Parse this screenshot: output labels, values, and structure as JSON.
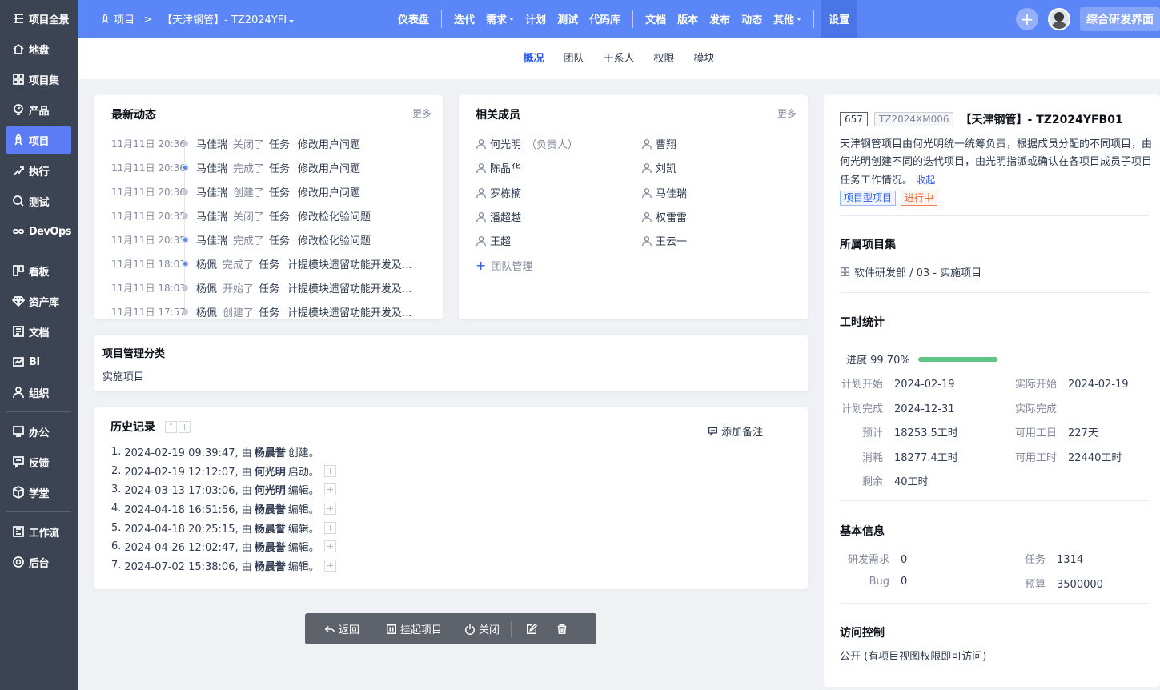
{
  "sidebar": {
    "items": [
      {
        "label": "项目全景",
        "icon": "dashboard-icon"
      },
      {
        "label": "地盘",
        "icon": "home-icon"
      },
      {
        "label": "项目集",
        "icon": "grid-icon"
      },
      {
        "label": "产品",
        "icon": "bulb-icon"
      },
      {
        "label": "项目",
        "icon": "rocket-icon"
      },
      {
        "label": "执行",
        "icon": "run-icon"
      },
      {
        "label": "测试",
        "icon": "search-icon"
      },
      {
        "label": "DevOps",
        "icon": "infinity-icon"
      },
      {
        "label": "看板",
        "icon": "kanban-icon"
      },
      {
        "label": "资产库",
        "icon": "diamond-icon"
      },
      {
        "label": "文档",
        "icon": "doc-icon"
      },
      {
        "label": "BI",
        "icon": "chart-icon"
      },
      {
        "label": "组织",
        "icon": "user-icon"
      },
      {
        "label": "办公",
        "icon": "monitor-icon"
      },
      {
        "label": "反馈",
        "icon": "feedback-icon"
      },
      {
        "label": "学堂",
        "icon": "cube-icon"
      },
      {
        "label": "工作流",
        "icon": "workflow-icon"
      },
      {
        "label": "后台",
        "icon": "settings-icon"
      }
    ]
  },
  "topbar": {
    "crumb_home": "项目",
    "crumb_project": "【天津钢管】- TZ2024YFI",
    "nav": [
      {
        "label": "仪表盘"
      },
      {
        "label": "迭代"
      },
      {
        "label": "需求"
      },
      {
        "label": "计划"
      },
      {
        "label": "测试"
      },
      {
        "label": "代码库"
      },
      {
        "label": "文档"
      },
      {
        "label": "版本"
      },
      {
        "label": "发布"
      },
      {
        "label": "动态"
      },
      {
        "label": "其他"
      },
      {
        "label": "设置"
      }
    ],
    "workspace": "综合研发界面"
  },
  "subnav": {
    "tabs": [
      "概况",
      "团队",
      "干系人",
      "权限",
      "模块"
    ]
  },
  "activity": {
    "title": "最新动态",
    "more": "更多",
    "rows": [
      {
        "time": "11月11日 20:36",
        "user": "马佳瑞",
        "action": "关闭了",
        "type": "任务",
        "object": "修改用户问题"
      },
      {
        "time": "11月11日 20:36",
        "user": "马佳瑞",
        "action": "完成了",
        "type": "任务",
        "object": "修改用户问题"
      },
      {
        "time": "11月11日 20:36",
        "user": "马佳瑞",
        "action": "创建了",
        "type": "任务",
        "object": "修改用户问题"
      },
      {
        "time": "11月11日 20:35",
        "user": "马佳瑞",
        "action": "关闭了",
        "type": "任务",
        "object": "修改检化验问题"
      },
      {
        "time": "11月11日 20:35",
        "user": "马佳瑞",
        "action": "完成了",
        "type": "任务",
        "object": "修改检化验问题"
      },
      {
        "time": "11月11日 18:03",
        "user": "杨佩",
        "action": "完成了",
        "type": "任务",
        "object": "计提模块遗留功能开发及..."
      },
      {
        "time": "11月11日 18:03",
        "user": "杨佩",
        "action": "开始了",
        "type": "任务",
        "object": "计提模块遗留功能开发及..."
      },
      {
        "time": "11月11日 17:57",
        "user": "杨佩",
        "action": "创建了",
        "type": "任务",
        "object": "计提模块遗留功能开发及..."
      }
    ]
  },
  "members": {
    "title": "相关成员",
    "more": "更多",
    "list": [
      {
        "name": "何光明",
        "role": "（负责人）"
      },
      {
        "name": "曹翔",
        "role": ""
      },
      {
        "name": "陈晶华",
        "role": ""
      },
      {
        "name": "刘凯",
        "role": ""
      },
      {
        "name": "罗栋楠",
        "role": ""
      },
      {
        "name": "马佳瑞",
        "role": ""
      },
      {
        "name": "潘超越",
        "role": ""
      },
      {
        "name": "权雷雷",
        "role": ""
      },
      {
        "name": "王超",
        "role": ""
      },
      {
        "name": "王云一",
        "role": ""
      }
    ],
    "manage": "团队管理"
  },
  "category": {
    "title": "项目管理分类",
    "value": "实施项目"
  },
  "history": {
    "title": "历史记录",
    "add_note": "添加备注",
    "rows": [
      {
        "idx": "1.",
        "date": "2024-02-19 09:39:47, 由",
        "user": "杨晨誉",
        "act": "创建。"
      },
      {
        "idx": "2.",
        "date": "2024-02-19 12:12:07, 由",
        "user": "何光明",
        "act": "启动。"
      },
      {
        "idx": "3.",
        "date": "2024-03-13 17:03:06, 由",
        "user": "何光明",
        "act": "编辑。"
      },
      {
        "idx": "4.",
        "date": "2024-04-18 16:51:56, 由",
        "user": "杨晨誉",
        "act": "编辑。"
      },
      {
        "idx": "5.",
        "date": "2024-04-18 20:25:15, 由",
        "user": "杨晨誉",
        "act": "编辑。"
      },
      {
        "idx": "6.",
        "date": "2024-04-26 12:02:47, 由",
        "user": "杨晨誉",
        "act": "编辑。"
      },
      {
        "idx": "7.",
        "date": "2024-07-02 15:38:06, 由",
        "user": "杨晨誉",
        "act": "编辑。"
      }
    ]
  },
  "toolbar": {
    "back": "返回",
    "suspend": "挂起项目",
    "close": "关闭"
  },
  "project": {
    "id": "657",
    "code": "TZ2024XM006",
    "name": "【天津钢管】- TZ2024YFB01",
    "desc": "天津钢管项目由何光明统一统筹负责，根据成员分配的不同项目，由何光明创建不同的迭代项目，由光明指派或确认在各项目成员子项目任务工作情况。",
    "collapse": "收起",
    "tag_type": "项目型项目",
    "tag_status": "进行中"
  },
  "program": {
    "title": "所属项目集",
    "value": "软件研发部 / 03 - 实施项目"
  },
  "effort": {
    "title": "工时统计",
    "progress_label": "进度 99.70%",
    "progress": 0.997,
    "plan_start_k": "计划开始",
    "plan_start_v": "2024-02-19",
    "real_start_k": "实际开始",
    "real_start_v": "2024-02-19",
    "plan_end_k": "计划完成",
    "plan_end_v": "2024-12-31",
    "real_end_k": "实际完成",
    "real_end_v": "",
    "est_k": "预计",
    "est_v": "18253.5工时",
    "avail_day_k": "可用工日",
    "avail_day_v": "227天",
    "cons_k": "消耗",
    "cons_v": "18277.4工时",
    "avail_hr_k": "可用工时",
    "avail_hr_v": "22440工时",
    "left_k": "剩余",
    "left_v": "40工时"
  },
  "basic": {
    "title": "基本信息",
    "req_k": "研发需求",
    "req_v": "0",
    "task_k": "任务",
    "task_v": "1314",
    "bug_k": "Bug",
    "bug_v": "0",
    "budget_k": "预算",
    "budget_v": "3500000"
  },
  "access": {
    "title": "访问控制",
    "value": "公开 (有项目视图权限即可访问)"
  },
  "colors": {
    "accent": "#5b86f7",
    "sidebar": "#3c4353",
    "progress": "#5fc487",
    "tag_blue": "#2e5cf0",
    "tag_orange": "#f0602f"
  }
}
